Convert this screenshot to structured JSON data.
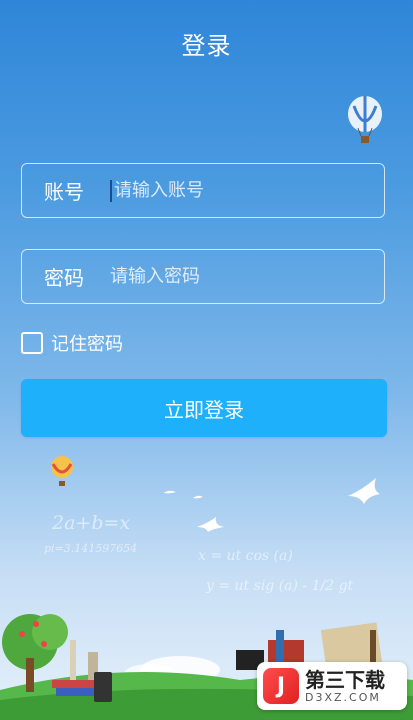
{
  "header": {
    "title": "登录"
  },
  "form": {
    "account_label": "账号",
    "account_placeholder": "请输入账号",
    "password_label": "密码",
    "password_placeholder": "请输入密码",
    "remember_label": "记住密码",
    "remember_checked": false,
    "submit_label": "立即登录"
  },
  "background": {
    "formulas": [
      "2a+b=x",
      "pi=3.141597654",
      "x = ut cos (a)",
      "y = ut sig (a) - 1/2 gt"
    ]
  },
  "watermark": {
    "name": "第三下载",
    "site": "D3XZ.COM",
    "logo_glyph": "J"
  },
  "colors": {
    "accent_button": "#1eb0fa",
    "sky_top": "#2f86d8",
    "text": "#ffffff"
  }
}
